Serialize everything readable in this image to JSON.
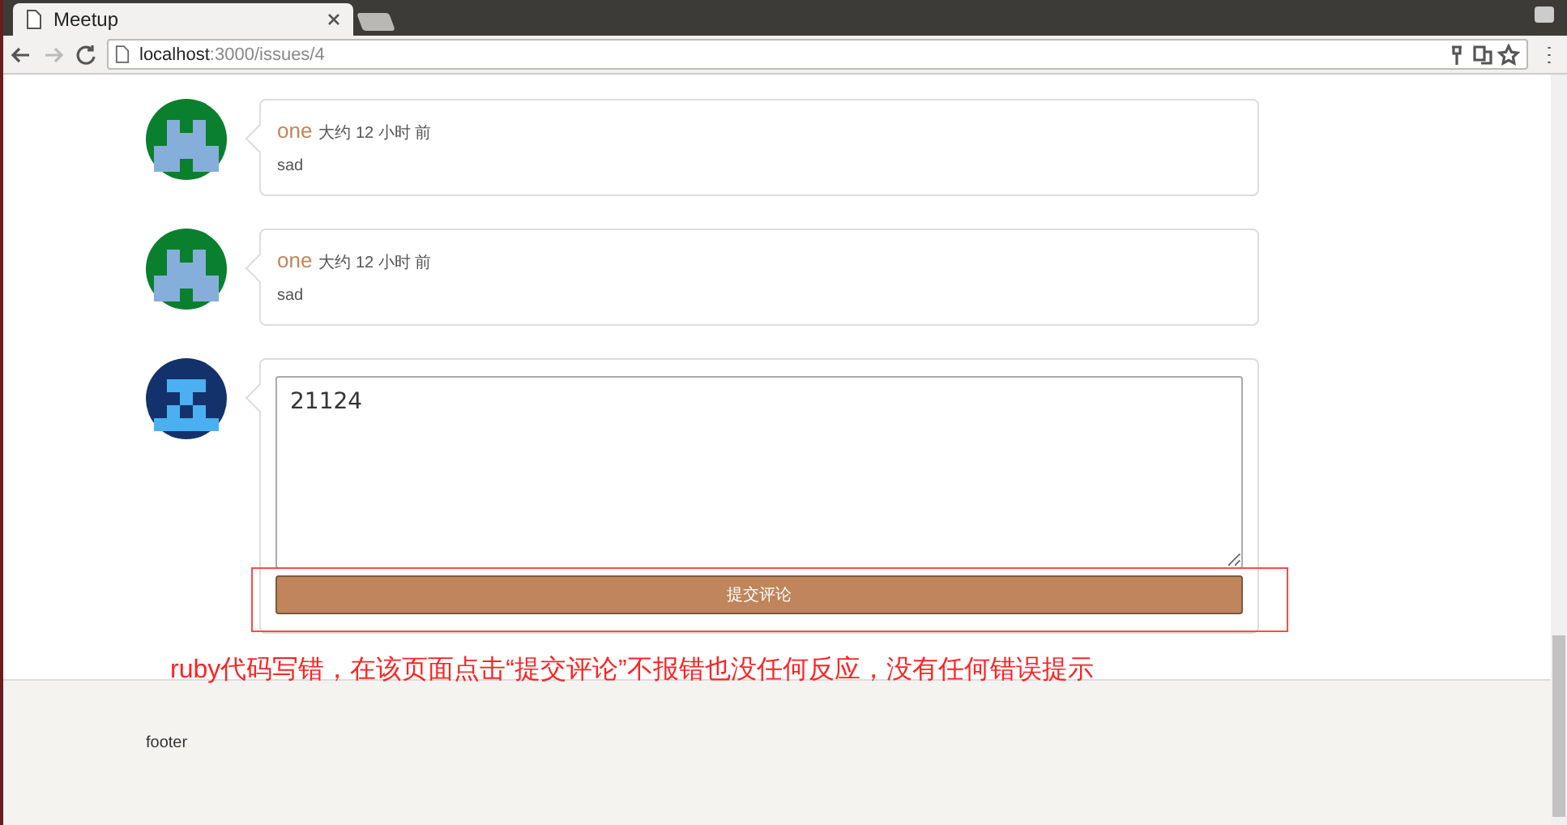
{
  "browser": {
    "tab_title": "Meetup",
    "url_host": "localhost",
    "url_path": ":3000/issues/4"
  },
  "comments": [
    {
      "author": "one",
      "time": "大约 12 小时 前",
      "body": "sad",
      "avatar": {
        "color": "#0a7f2e"
      }
    },
    {
      "author": "one",
      "time": "大约 12 小时 前",
      "body": "sad",
      "avatar": {
        "color": "#0a7f2e"
      }
    }
  ],
  "new_comment": {
    "avatar": {
      "color": "#13326b"
    },
    "value": "21124",
    "submit": "提交评论"
  },
  "annotation": "ruby代码写错，在该页面点击“提交评论”不报错也没任何反应，没有任何错误提示",
  "footer": "footer"
}
